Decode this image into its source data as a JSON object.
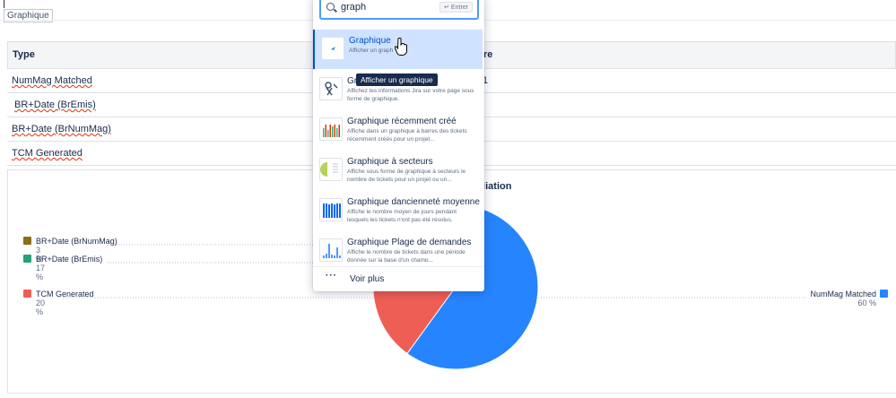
{
  "tag": "Graphique",
  "table": {
    "col1": "Type",
    "col2": "re",
    "rows": [
      {
        "type": "NumMag Matched",
        "value": "1"
      },
      {
        "type": "BR+Date (BrEmis)",
        "value": ""
      },
      {
        "type": "BR+Date (BrNumMag)",
        "value": ""
      },
      {
        "type": "TCM Generated",
        "value": ""
      }
    ]
  },
  "chart": {
    "title_fragment": "iliation",
    "legend": [
      {
        "label": "BR+Date (BrNumMag)",
        "pct": "3 %",
        "color": "#8f6e14"
      },
      {
        "label": "BR+Date (BrEmis)",
        "pct": "17 %",
        "color": "#26a27a"
      },
      {
        "label": "TCM Generated",
        "pct": "20 %",
        "color": "#ef5e55"
      },
      {
        "label": "NumMag Matched",
        "pct": "60 %",
        "color": "#2684ff"
      }
    ]
  },
  "chart_data": {
    "type": "pie",
    "categories": [
      "NumMag Matched",
      "TCM Generated",
      "BR+Date (BrEmis)",
      "BR+Date (BrNumMag)"
    ],
    "values": [
      60,
      20,
      17,
      3
    ],
    "colors": [
      "#2684ff",
      "#ef5e55",
      "#26a27a",
      "#8f6e14"
    ]
  },
  "dropdown": {
    "query": "graph",
    "enter_hint": "↵ Entrer",
    "items": [
      {
        "title": "Graphique",
        "desc": "Afficher un graph",
        "icon": "chart-dot-icon"
      },
      {
        "title": "Gr",
        "desc": "Affichez les informations Jira sur votre page sous forme de graphique.",
        "icon": "jira-chart-icon"
      },
      {
        "title": "Graphique récemment créé",
        "desc": "Affiche dans un graphique à barres des tickets récemment créés pour un projet...",
        "icon": "bar-chart-icon"
      },
      {
        "title": "Graphique à secteurs",
        "desc": "Affiche sous forme de graphique à secteurs le nombre de tickets pour un projet ou un...",
        "icon": "pie-chart-icon"
      },
      {
        "title": "Graphique dancienneté moyenne",
        "desc": "Affiche le nombre moyen de jours pendant lesquels les tickets n'ont pas été résolus.",
        "icon": "age-chart-icon"
      },
      {
        "title": "Graphique Plage de demandes",
        "desc": "Affiche le nombre de tickets dans une période donnée sur la base d'un champ...",
        "icon": "range-chart-icon"
      }
    ],
    "more_label": "Voir plus",
    "more_icon": "···"
  },
  "tooltip": "Afficher un graphique"
}
